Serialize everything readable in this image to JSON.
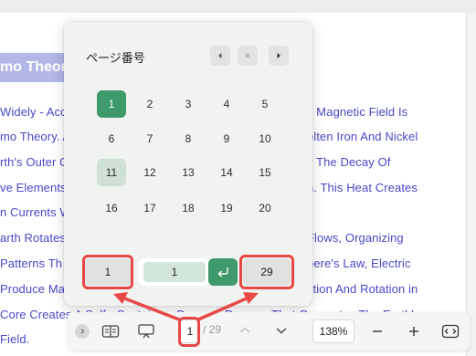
{
  "document": {
    "heading": "mo Theory",
    "lines": [
      "Widely - Acc",
      "mo Theory. A",
      "rth's Outer C",
      "ve Elements",
      "n Currents W",
      "arth Rotates,",
      " Patterns Th",
      "Produce Mag",
      "Core Creates A Self - Sustaining Dynamo Process That Generates The Earth's",
      "Field."
    ],
    "lines_right": [
      "s Magnetic Field Is",
      "olten Iron And Nickel",
      "y The Decay Of",
      "n. This Heat Creates",
      "Flows, Organizing",
      "pere's Law, Electric",
      "ction And Rotation in"
    ]
  },
  "popup": {
    "title": "ページ番号",
    "pages": [
      "1",
      "2",
      "3",
      "4",
      "5",
      "6",
      "7",
      "8",
      "9",
      "10",
      "11",
      "12",
      "13",
      "14",
      "15",
      "16",
      "17",
      "18",
      "19",
      "20"
    ],
    "current_page": "1",
    "hover_page": "11",
    "first_page": "1",
    "input_value": "1",
    "last_page": "29"
  },
  "toolbar": {
    "page_number": "1",
    "page_total": "/ 29",
    "zoom": "138%"
  },
  "colors": {
    "accent_green": "#3f9a6b",
    "hover_green": "#cfe0d4",
    "link_text": "#4a47c7",
    "annotation_red": "#e84848"
  },
  "icons": [
    "chevron-left-icon",
    "dot-icon",
    "chevron-right-icon",
    "enter-icon",
    "sidebar-toggle-icon",
    "book-view-icon",
    "presentation-icon",
    "chevron-up-icon",
    "chevron-down-icon",
    "zoom-out-icon",
    "zoom-in-icon",
    "fit-width-icon"
  ]
}
